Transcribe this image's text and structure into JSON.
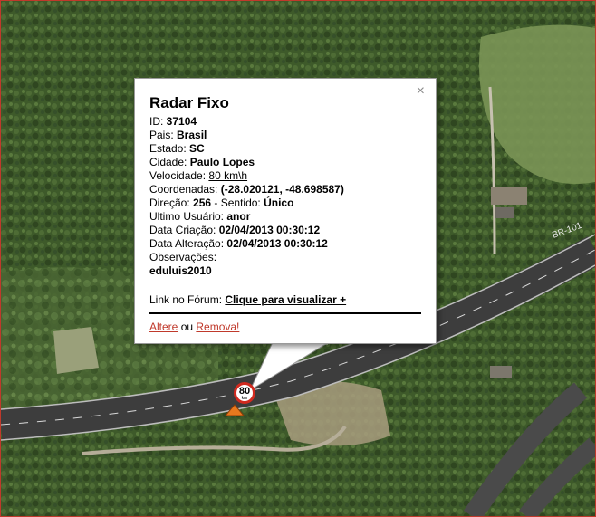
{
  "popup": {
    "title": "Radar Fixo",
    "id_label": "ID: ",
    "id_value": "37104",
    "pais_label": "Pais: ",
    "pais_value": "Brasil",
    "estado_label": "Estado: ",
    "estado_value": "SC",
    "cidade_label": "Cidade: ",
    "cidade_value": "Paulo Lopes",
    "velocidade_label": "Velocidade: ",
    "velocidade_value": "80 km\\h",
    "coordenadas_label": "Coordenadas: ",
    "coordenadas_value": "(-28.020121, -48.698587)",
    "direcao_label": "Direção: ",
    "direcao_value": "256",
    "sentido_label": " - Sentido: ",
    "sentido_value": "Único",
    "usuario_label": "Ultimo Usuário: ",
    "usuario_value": "anor",
    "criacao_label": "Data Criação: ",
    "criacao_value": "02/04/2013 00:30:12",
    "alteracao_label": "Data Alteração: ",
    "alteracao_value": "02/04/2013 00:30:12",
    "observacoes_label": "Observações:",
    "observacoes_value": "eduluis2010",
    "forum_label": "Link no Fórum: ",
    "forum_link": "Clique para visualizar +",
    "altere_link": "Altere",
    "ou_text": " ou ",
    "remova_link": "Remova!",
    "close_icon": "×"
  },
  "speed_sign": {
    "value": "80",
    "unit": "km"
  },
  "map": {
    "road_label": "BR-101"
  },
  "colors": {
    "sign_border": "#d12a1f",
    "link_red": "#c0392b",
    "marker_orange": "#e8781e"
  }
}
